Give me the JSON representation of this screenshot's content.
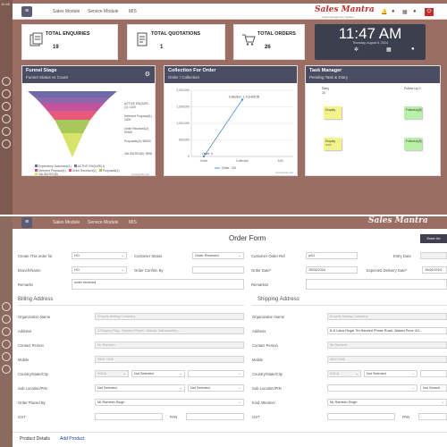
{
  "top": {
    "rail_time": "10:46",
    "nav": [
      "Sales Module",
      "Service Module",
      "MIS"
    ],
    "logo": "Sales Mantra",
    "logo_sub": "Lead management System",
    "stats": [
      {
        "title": "TOTAL ENQUIRIES",
        "value": "19",
        "icon": "enquiry-icon"
      },
      {
        "title": "TOTAL QUOTATIONS",
        "value": "1",
        "icon": "quotation-icon"
      },
      {
        "title": "TOTAL ORDERS",
        "value": "26",
        "icon": "cart-icon"
      }
    ],
    "clock": {
      "time": "11:47 AM",
      "date": "Thursday, August 8, 2024"
    },
    "funnel": {
      "title": "Funnel Stage",
      "subtitle": "Funnel Status vs Count",
      "labels": [
        "ACTIVE ENQUIRI...(1): 1100",
        "Deferred Proposal(1): 1000",
        "Order Received(2): 91600",
        "Proposals(3): 56000",
        "VALIDATED(6): 9908"
      ],
      "legend": [
        "Exploratory Data bank(1)",
        "ACTIVE ENQUIRI(1)",
        "Deferred Proposal(1)",
        "Order Received(2)",
        "Proposals(3)",
        "VALIDATED(6)"
      ],
      "colors": [
        "#6f6aa8",
        "#8a68b0",
        "#c2549f",
        "#e85a7c",
        "#a9c85a",
        "#d8e36a"
      ],
      "credit": "CanvasJS.com"
    },
    "collection": {
      "title": "Collection For Order",
      "subtitle": "Order / Collection",
      "legend": "Order - 3/6",
      "credit": "CanvasJS.com"
    },
    "tasks": {
      "title": "Task Manager",
      "subtitle": "Pending Task & Diary",
      "col1": "Diary",
      "col1_count": "10",
      "col2": "Follow Up 0",
      "notes": [
        {
          "text": "Enquiry",
          "sub": "...",
          "color": "#f3f38a"
        },
        {
          "text": "FollowUp(5)",
          "color": "#b9f0a8"
        },
        {
          "text": "Enquiry",
          "sub": "work",
          "color": "#f3f38a"
        },
        {
          "text": "FollowUp(5)",
          "color": "#b9f0a8"
        }
      ]
    }
  },
  "chart_data": {
    "type": "line",
    "title": "",
    "xlabel": "",
    "ylabel": "",
    "x": [
      "Order",
      "Collection",
      "AHC"
    ],
    "series": [
      {
        "name": "Order - 3/6",
        "values": [
          0,
          1716405.08,
          null
        ]
      }
    ],
    "ylim": [
      0,
      2000000
    ],
    "yticks": [
      "2,000,000",
      "1,500,000",
      "1,000,000",
      "500,000",
      "0"
    ],
    "data_labels": [
      "Order: 0",
      "Collection: 1,716,405.08"
    ]
  },
  "bottom": {
    "nav": [
      "Sales Module",
      "Service Module",
      "MIS"
    ],
    "logo": "Sales Mantra",
    "form_title": "Order Form",
    "enter_btn": "Enter Ite",
    "fields": {
      "created_for_label": "Create This order for",
      "created_for_value": "HO",
      "customer_status_label": "Customer Status",
      "customer_status_value": "Order Received",
      "customer_po_label": "Customer Order Ref",
      "customer_po_value": "p/01",
      "entry_date_label": "Entry Date",
      "branch_label": "Branch/Name",
      "branch_value": "HO",
      "order_confirm_label": "Order Confirm By",
      "order_date_label": "Order Date*",
      "order_date_value": "15/04/2024",
      "delivery_label": "Expected Delivery Date*",
      "delivery_value": "15/04/2024",
      "remarks_label": "Remarks",
      "remarks_value": "order received",
      "remarks2_label": "Remarks2"
    },
    "billing": {
      "heading": "Billing Address",
      "org_label": "Organization Name",
      "org_value": "Enquiry testing Company",
      "address_label": "Address",
      "address_value": "A Enquiry Raju, Nanded Pimpri, Wakad, Maharashtra, ..",
      "contact_label": "Contact Person",
      "contact_value": "Mr Ramesh",
      "mobile_label": "Mobile",
      "mobile_value": "9890 7655",
      "country_label": "Country/State/City",
      "country_value": "INDIA",
      "state_value": "Not Selected",
      "sublocation_label": "Sub Location/PIN",
      "sublocation_value": "Not Selected",
      "sublocation_value2": "Not Selected",
      "placed_by_label": "Order Placed By",
      "placed_by_value": "Mr Ramesh Singh",
      "gst_label": "GST",
      "pan_label": "PAN"
    },
    "shipping": {
      "heading": "Shipping Address",
      "org_label": "Organization Name",
      "org_value": "Enquiry testing Company",
      "address_label": "Address",
      "address_value": "B-6 Lotus Regal 7th Nanded Phase Road, Wakad Pune 411..",
      "contact_label": "Contact Person",
      "contact_value": "Mr Ramesh",
      "mobile_label": "Mobile",
      "mobile_value": "98907655",
      "country_label": "Country/State/City",
      "country_value": "INDIA",
      "state_value": "Not Selected",
      "sublocation_label": "Sub Location/PIN",
      "sublocation_value2": "Not Search",
      "kind_attn_label": "Kind Attention",
      "kind_attn_value": "Mr Ramesh Singh",
      "gst_label": "GST",
      "pan_label": "PAN"
    },
    "tabs": [
      "Product Details",
      "Add Product"
    ]
  }
}
